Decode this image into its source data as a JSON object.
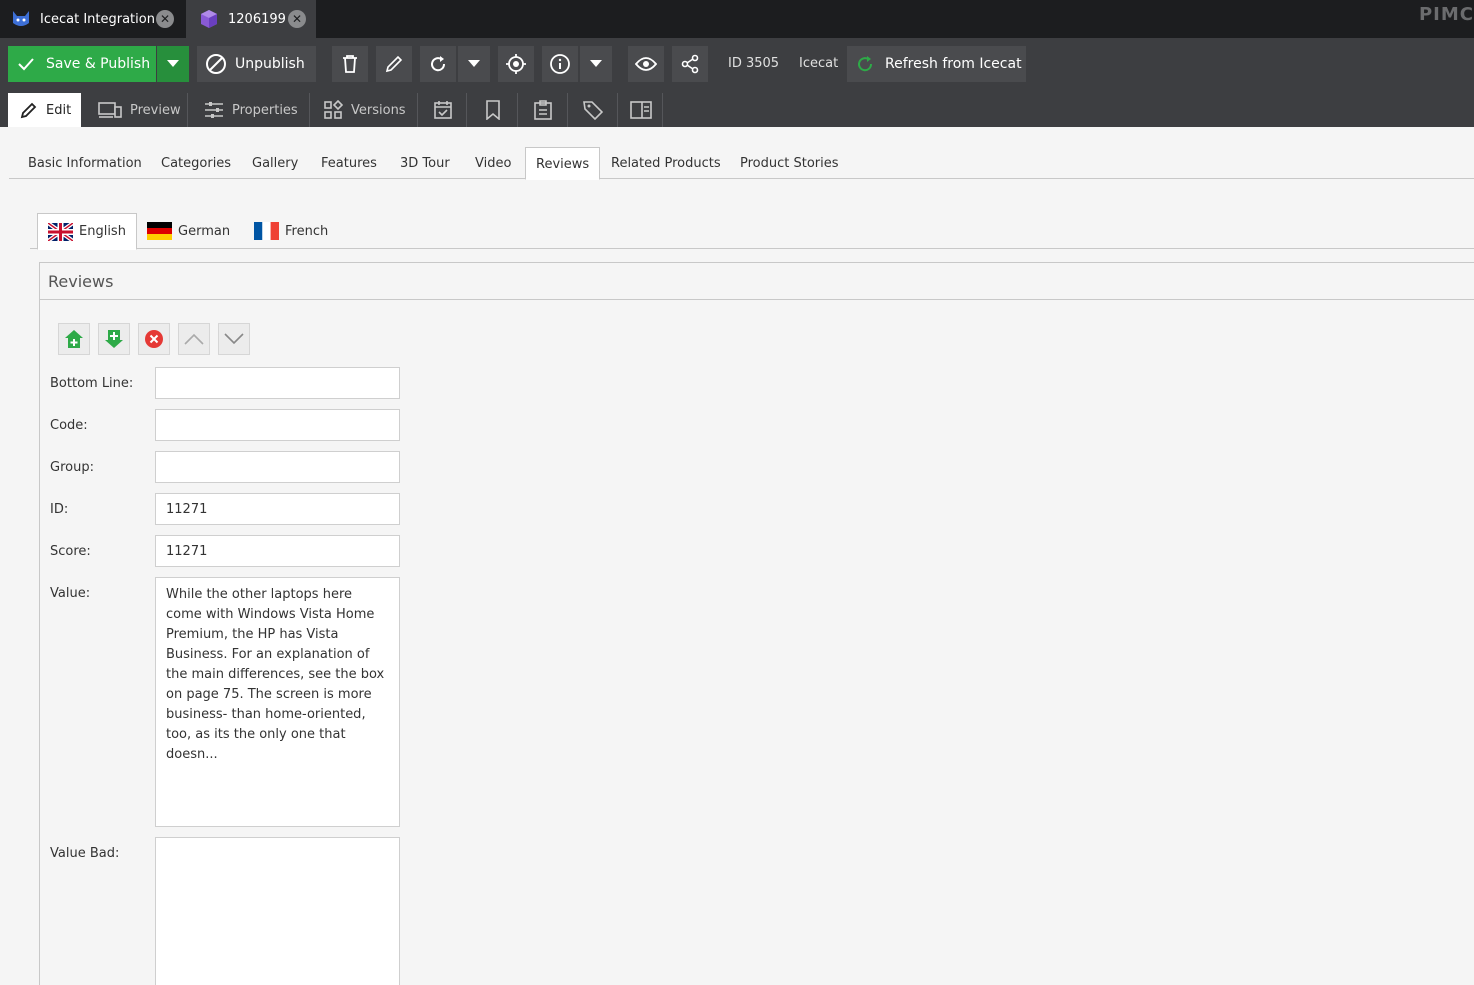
{
  "window_tabs": [
    {
      "label": "Icecat Integration",
      "icon": "cat-icon"
    },
    {
      "label": "1206199",
      "icon": "cube-icon"
    }
  ],
  "brand": "PIMC",
  "toolbar": {
    "save_publish": "Save & Publish",
    "unpublish": "Unpublish",
    "id_label": "ID 3505",
    "source_label": "Icecat",
    "refresh": "Refresh from Icecat"
  },
  "edit_tabs": [
    {
      "label": "Edit",
      "active": true
    },
    {
      "label": "Preview"
    },
    {
      "label": "Properties"
    },
    {
      "label": "Versions"
    }
  ],
  "sub_tabs": [
    {
      "label": "Basic Information"
    },
    {
      "label": "Categories"
    },
    {
      "label": "Gallery"
    },
    {
      "label": "Features"
    },
    {
      "label": "3D Tour"
    },
    {
      "label": "Video"
    },
    {
      "label": "Reviews",
      "active": true
    },
    {
      "label": "Related Products"
    },
    {
      "label": "Product Stories"
    }
  ],
  "languages": [
    {
      "label": "English",
      "active": true
    },
    {
      "label": "German"
    },
    {
      "label": "French"
    }
  ],
  "panel": {
    "title": "Reviews",
    "fields": {
      "bottom_line": {
        "label": "Bottom Line:",
        "value": ""
      },
      "code": {
        "label": "Code:",
        "value": ""
      },
      "group": {
        "label": "Group:",
        "value": ""
      },
      "id": {
        "label": "ID:",
        "value": "11271"
      },
      "score": {
        "label": "Score:",
        "value": "11271"
      },
      "value": {
        "label": "Value:",
        "value": "While the other laptops here come with Windows Vista Home Premium, the HP has Vista Business. For an explanation of the main differences, see the box on page 75. The screen is more business- than home-oriented, too, as its the only one that doesn..."
      },
      "value_bad": {
        "label": "Value Bad:",
        "value": ""
      }
    }
  },
  "colors": {
    "publish_green": "#2eaa48",
    "dark_bg": "#3d3e41",
    "tabstrip_bg": "#1c1d1f"
  }
}
